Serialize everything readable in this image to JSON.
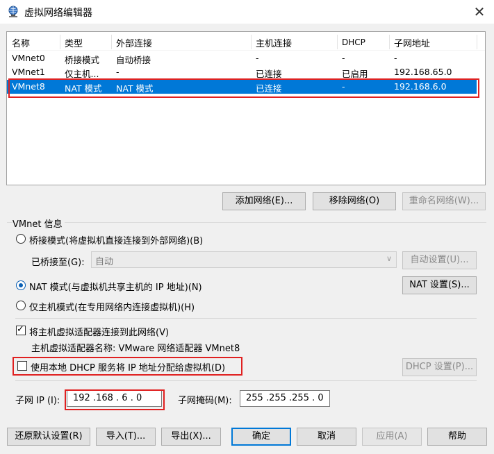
{
  "window": {
    "title": "虚拟网络编辑器",
    "close": "✕"
  },
  "table": {
    "headers": [
      "名称",
      "类型",
      "外部连接",
      "主机连接",
      "DHCP",
      "子网地址"
    ],
    "rows": [
      {
        "name": "VMnet0",
        "type": "桥接模式",
        "external": "自动桥接",
        "host": "-",
        "dhcp": "-",
        "subnet": "-"
      },
      {
        "name": "VMnet1",
        "type": "仅主机...",
        "external": "-",
        "host": "已连接",
        "dhcp": "已启用",
        "subnet": "192.168.65.0"
      },
      {
        "name": "VMnet8",
        "type": "NAT 模式",
        "external": "NAT 模式",
        "host": "已连接",
        "dhcp": "-",
        "subnet": "192.168.6.0",
        "selected": true
      }
    ]
  },
  "table_buttons": {
    "add": "添加网络(E)...",
    "remove": "移除网络(O)",
    "rename": "重命名网络(W)..."
  },
  "info": {
    "group_label": "VMnet 信息",
    "bridge_radio": "桥接模式(将虚拟机直接连接到外部网络)(B)",
    "bridged_to_label": "已桥接至(G):",
    "bridged_to_value": "自动",
    "auto_settings": "自动设置(U)...",
    "nat_radio": "NAT 模式(与虚拟机共享主机的 IP 地址)(N)",
    "nat_settings": "NAT 设置(S)...",
    "hostonly_radio": "仅主机模式(在专用网络内连接虚拟机)(H)",
    "connect_adapter": "将主机虚拟适配器连接到此网络(V)",
    "adapter_name": "主机虚拟适配器名称: VMware 网络适配器 VMnet8",
    "use_dhcp": "使用本地 DHCP 服务将 IP 地址分配给虚拟机(D)",
    "dhcp_settings": "DHCP 设置(P)...",
    "subnet_ip_label": "子网 IP (I):",
    "subnet_ip": "192 .168 .  6  .  0",
    "subnet_mask_label": "子网掩码(M):",
    "subnet_mask": "255 .255 .255 .  0"
  },
  "footer": {
    "restore": "还原默认设置(R)",
    "import": "导入(T)...",
    "export": "导出(X)...",
    "ok": "确定",
    "cancel": "取消",
    "apply": "应用(A)",
    "help": "帮助"
  },
  "colors": {
    "selection": "#0078d7",
    "highlight": "#e02020",
    "background": "#f0f0f0"
  }
}
